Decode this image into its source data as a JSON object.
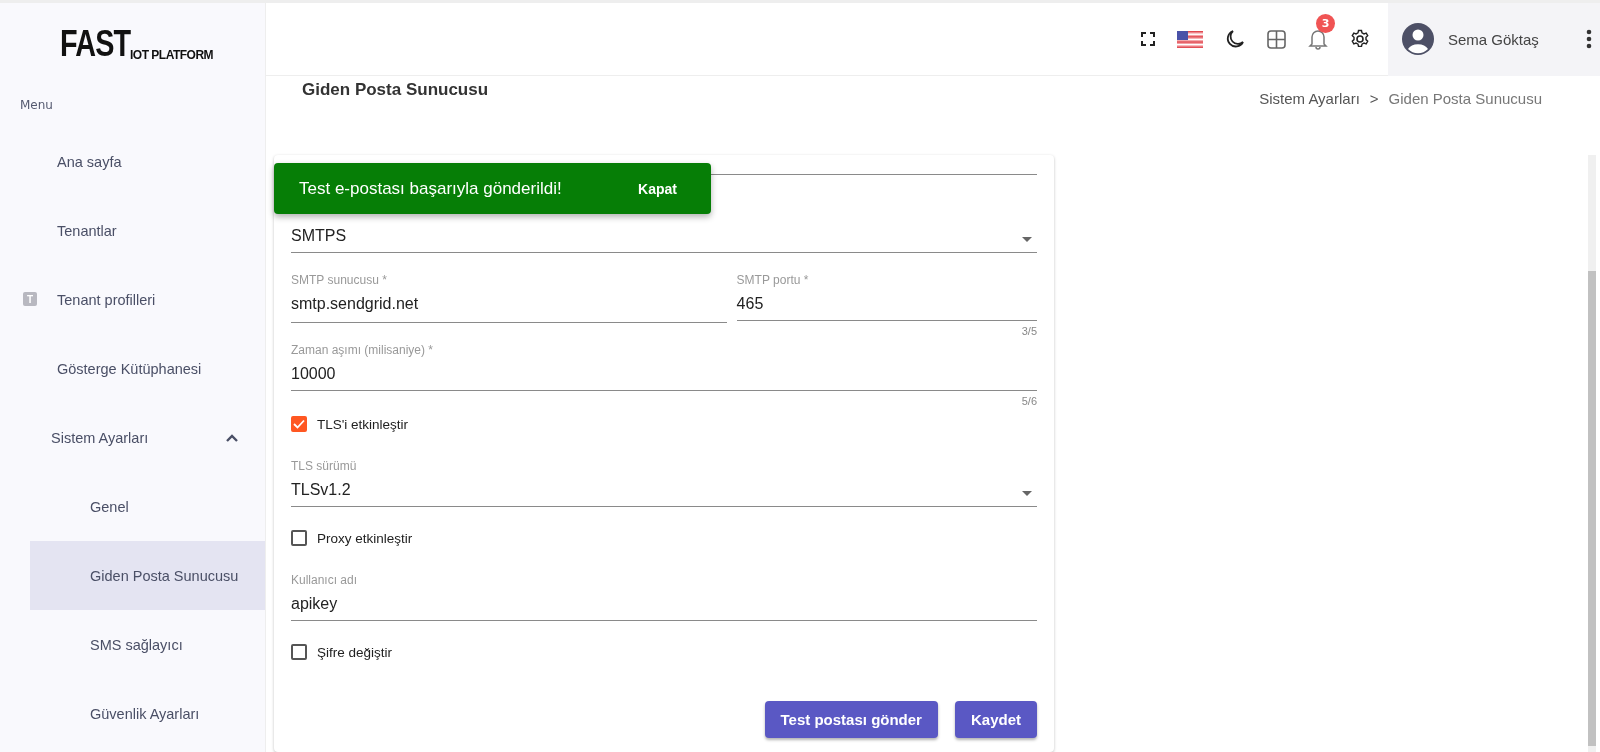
{
  "logo": {
    "big": "FAST",
    "small": "IOT PLATFORM"
  },
  "sidebar": {
    "heading": "Menu",
    "items": [
      {
        "label": "Ana sayfa",
        "selected": false
      },
      {
        "label": "Tenantlar",
        "selected": false
      },
      {
        "label": "Tenant profilleri",
        "selected": false,
        "badge": "T"
      },
      {
        "label": "Gösterge Kütüphanesi",
        "selected": false
      },
      {
        "label": "Sistem Ayarları",
        "selected": false,
        "expanded": true,
        "children": [
          {
            "label": "Genel",
            "selected": false
          },
          {
            "label": "Giden Posta Sunucusu",
            "selected": true
          },
          {
            "label": "SMS sağlayıcı",
            "selected": false
          },
          {
            "label": "Güvenlik Ayarları",
            "selected": false
          }
        ]
      }
    ]
  },
  "header": {
    "notifications": "3",
    "user": "Sema Göktaş"
  },
  "page": {
    "title": "Giden Posta Sunucusu",
    "breadcrumb": [
      "Sistem Ayarları",
      "Giden Posta Sunucusu"
    ],
    "separator": ">"
  },
  "form": {
    "fields": [
      {
        "kind": "text"
      },
      {
        "kind": "select",
        "value": "SMTPS"
      },
      {
        "kind": "pair",
        "items": [
          {
            "label": "SMTP sunucusu *",
            "value": "smtp.sendgrid.net"
          },
          {
            "label": "SMTP portu *",
            "value": "465",
            "hint": "3/5"
          }
        ]
      },
      {
        "kind": "text",
        "label": "Zaman aşımı (milisaniye) *",
        "value": "10000",
        "hint": "5/6"
      },
      {
        "kind": "checkbox",
        "label": "TLS'i etkinleştir",
        "checked": true
      },
      {
        "kind": "select",
        "label": "TLS sürümü",
        "value": "TLSv1.2"
      },
      {
        "kind": "checkbox",
        "label": "Proxy etkinleştir",
        "checked": false
      },
      {
        "kind": "text",
        "label": "Kullanıcı adı",
        "value": "apikey"
      },
      {
        "kind": "checkbox",
        "label": "Şifre değiştir",
        "checked": false
      }
    ],
    "buttons": [
      "Test postası gönder",
      "Kaydet"
    ]
  },
  "toast": {
    "message": "Test e-postası başarıyla gönderildi!",
    "action": "Kapat"
  }
}
